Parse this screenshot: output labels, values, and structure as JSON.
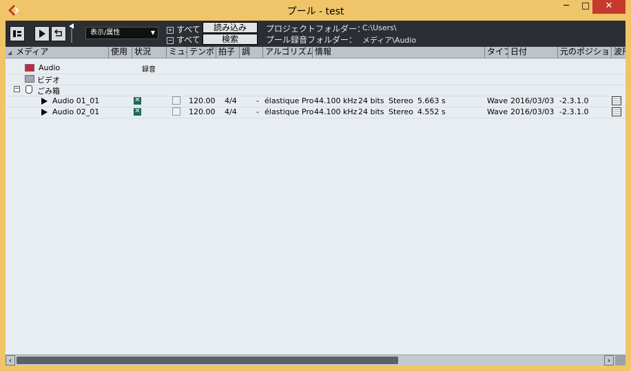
{
  "window": {
    "title": "プール - test",
    "controls": {
      "minimize": "─",
      "maximize": "□",
      "close": "✕"
    }
  },
  "toolbar": {
    "view_select": "表示/属性",
    "expand_all": "すべて",
    "collapse_all": "すべて",
    "import_button": "読み込み",
    "search_button": "検索",
    "project_folder_label": "プロジェクトフォルダー：",
    "project_folder_value": "C:\\Users\\",
    "record_folder_label": "プール録音フォルダー：",
    "record_folder_value": "メディア\\Audio"
  },
  "columns": {
    "media": "メディア",
    "used": "使用",
    "status": "状況",
    "mute": "ミュ-",
    "tempo": "テンポ",
    "signature": "拍子",
    "key": "調",
    "algorithm": "アルゴリズム",
    "info": "情報",
    "type": "タイプ",
    "date": "日付",
    "origin": "元のポジション",
    "waveform": "波形"
  },
  "folders": {
    "audio": {
      "name": "Audio",
      "status": "録音"
    },
    "video": {
      "name": "ビデオ"
    },
    "trash": {
      "name": "ごみ箱"
    }
  },
  "clips": [
    {
      "name": "Audio 01_01",
      "tempo": "120.00",
      "signature": "4/4",
      "key": "-",
      "algorithm": "élastique Pro",
      "samplerate": "44.100 kHz",
      "bits": "24 bits",
      "channels": "Stereo",
      "length": "5.663 s",
      "type": "Wave",
      "date": "2016/03/03",
      "origin": "-2.3.1.0"
    },
    {
      "name": "Audio 02_01",
      "tempo": "120.00",
      "signature": "4/4",
      "key": "-",
      "algorithm": "élastique Pro",
      "samplerate": "44.100 kHz",
      "bits": "24 bits",
      "channels": "Stereo",
      "length": "4.552 s",
      "type": "Wave",
      "date": "2016/03/03",
      "origin": "-2.3.1.0"
    }
  ],
  "colors": {
    "accent": "#f0c56a",
    "toolbar": "#2b2e33",
    "close": "#c7392e"
  }
}
